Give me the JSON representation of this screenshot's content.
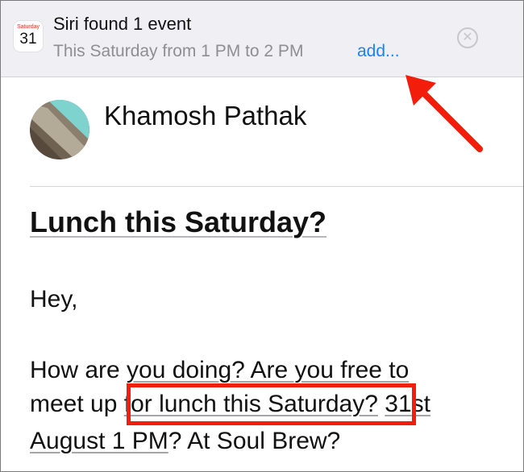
{
  "banner": {
    "calendar_icon_day": "Saturday",
    "calendar_icon_date": "31",
    "title": "Siri found 1 event",
    "subtitle": "This Saturday from 1 PM to 2 PM",
    "add_label": "add...",
    "close_icon": "close-circle-icon"
  },
  "email": {
    "sender": "Khamosh Pathak",
    "subject": "Lunch this Saturday?",
    "greeting": "Hey,",
    "body": {
      "l1_a": "How are ",
      "l1_b": "you doing? Are you free to",
      "l2_a": "meet up ",
      "l2_b": "for lunch this Saturday?",
      "l2_c": " ",
      "l2_d": "31st",
      "l3_a": "August 1 PM",
      "l3_b": "? At Soul Brew?"
    }
  },
  "annotation": {
    "color": "#f21d0b"
  },
  "colors": {
    "link_blue": "#1a82fb",
    "banner_bg": "#efeff4"
  }
}
